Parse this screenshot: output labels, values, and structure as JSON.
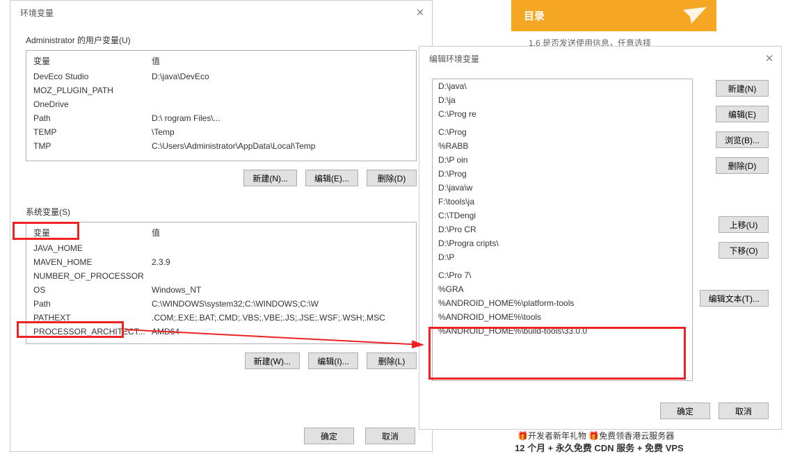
{
  "orange": {
    "title": "目录",
    "sub": "1.6 是否发送使用信息，任意选择"
  },
  "dlg1": {
    "title": "环境变量",
    "userTitle": "Administrator 的用户变量(U)",
    "userHeader": {
      "var": "变量",
      "val": "值"
    },
    "userRows": [
      {
        "var": "DevEco Studio",
        "val": "D:\\java\\DevEco"
      },
      {
        "var": "MOZ_PLUGIN_PATH",
        "val": ""
      },
      {
        "var": "OneDrive",
        "val": ""
      },
      {
        "var": "Path",
        "val": "D:\\                                                                                          rogram Files\\..."
      },
      {
        "var": "TEMP",
        "val": "\\Temp"
      },
      {
        "var": "TMP",
        "val": "C:\\Users\\Administrator\\AppData\\Local\\Temp"
      }
    ],
    "sysTitle": "系统变量(S)",
    "sysHeader": {
      "var": "变量",
      "val": "值"
    },
    "sysRows": [
      {
        "var": "JAVA_HOME",
        "val": ""
      },
      {
        "var": "MAVEN_HOME",
        "val": "                                           2.3.9"
      },
      {
        "var": "NUMBER_OF_PROCESSOR",
        "val": ""
      },
      {
        "var": "OS",
        "val": "Windows_NT"
      },
      {
        "var": "Path",
        "val": "C:\\WINDOWS\\system32;C:\\WINDOWS;C:\\W"
      },
      {
        "var": "PATHEXT",
        "val": ".COM;.EXE;.BAT;.CMD;.VBS;.VBE;.JS;.JSE;.WSF;.WSH;.MSC"
      },
      {
        "var": "PROCESSOR_ARCHITECT...",
        "val": "AMD64"
      }
    ],
    "btns": {
      "newU": "新建(N)...",
      "editU": "编辑(E)...",
      "delU": "删除(D)",
      "newS": "新建(W)...",
      "editS": "编辑(I)...",
      "delS": "删除(L)",
      "ok": "确定",
      "cancel": "取消"
    }
  },
  "dlg2": {
    "title": "编辑环境变量",
    "items": [
      "D:\\java\\",
      "D:\\ja",
      "C:\\Prog                                                                                                                        re",
      "",
      "C:\\Prog",
      "%RABB",
      "D:\\P                                                            oin",
      "D:\\Prog",
      "D:\\java\\w",
      "F:\\tools\\ja",
      "C:\\TDengi",
      "D:\\Pro                                                                           CR",
      "D:\\Progra                                                                                         cripts\\",
      "D:\\P",
      "",
      "C:\\Pro                                                                              7\\",
      "%GRA",
      "%ANDROID_HOME%\\platform-tools",
      "%ANDROID_HOME%\\tools",
      "%ANDROID_HOME%\\build-tools\\33.0.0"
    ],
    "btns": {
      "new": "新建(N)",
      "edit": "编辑(E)",
      "browse": "浏览(B)...",
      "del": "删除(D)",
      "up": "上移(U)",
      "down": "下移(O)",
      "editText": "编辑文本(T)...",
      "ok": "确定",
      "cancel": "取消"
    }
  },
  "ad": {
    "line1": "🎁开发者新年礼物 🎁免费领香港云服务器",
    "line2": "12 个月 + 永久免费 CDN 服务 + 免费 VPS"
  }
}
